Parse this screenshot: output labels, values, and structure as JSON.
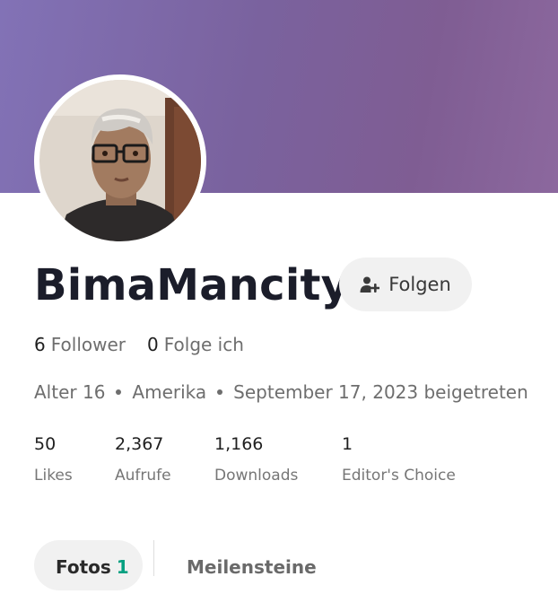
{
  "profile": {
    "username": "BimaMancity",
    "follow_label": "Folgen"
  },
  "follow_stats": {
    "followers_count": "6",
    "followers_label": "Follower",
    "following_count": "0",
    "following_label": "Folge ich"
  },
  "meta": {
    "age": "Alter 16",
    "location": "Amerika",
    "joined": "September 17, 2023 beigetreten"
  },
  "stats": [
    {
      "value": "50",
      "label": "Likes"
    },
    {
      "value": "2,367",
      "label": "Aufrufe"
    },
    {
      "value": "1,166",
      "label": "Downloads"
    },
    {
      "value": "1",
      "label": "Editor's Choice"
    }
  ],
  "tabs": [
    {
      "label": "Fotos",
      "count": "1"
    },
    {
      "label": "Meilensteine"
    }
  ],
  "colors": {
    "cover": "#7a629e",
    "accent_count": "#05a081",
    "username": "#1b1d2a"
  },
  "icons": {
    "follow": "user-plus-icon"
  }
}
